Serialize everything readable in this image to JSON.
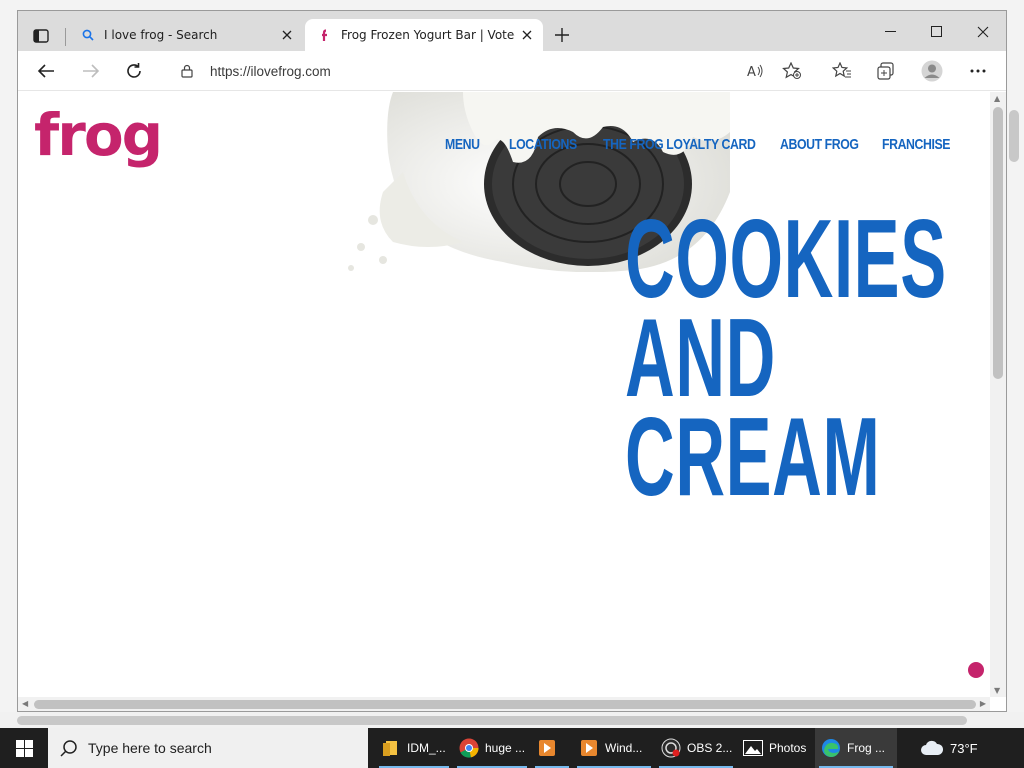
{
  "browser": {
    "tabs": [
      {
        "title": "I love frog - Search",
        "icon": "search-icon"
      },
      {
        "title": "Frog Frozen Yogurt Bar | Voted b",
        "icon": "frog-favicon"
      }
    ],
    "url": "https://ilovefrog.com"
  },
  "site": {
    "logo": "frog",
    "nav": [
      "MENU",
      "LOCATIONS",
      "THE FROG LOYALTY CARD",
      "ABOUT FROG",
      "FRANCHISE"
    ],
    "headline": [
      "COOKIES",
      "AND",
      "CREAM"
    ],
    "colors": {
      "brand_pink": "#c5246c",
      "brand_blue": "#1565c0"
    }
  },
  "taskbar": {
    "search_placeholder": "Type here to search",
    "items": [
      {
        "label": "IDM_...",
        "icon": "folder-icon"
      },
      {
        "label": "huge ...",
        "icon": "chrome-icon"
      },
      {
        "label": "",
        "icon": "media-player-icon"
      },
      {
        "label": "Wind...",
        "icon": "media-player-icon"
      },
      {
        "label": "OBS 2...",
        "icon": "obs-icon"
      },
      {
        "label": "Photos",
        "icon": "photos-icon"
      },
      {
        "label": "Frog ...",
        "icon": "edge-icon"
      }
    ],
    "weather": "73°F"
  }
}
